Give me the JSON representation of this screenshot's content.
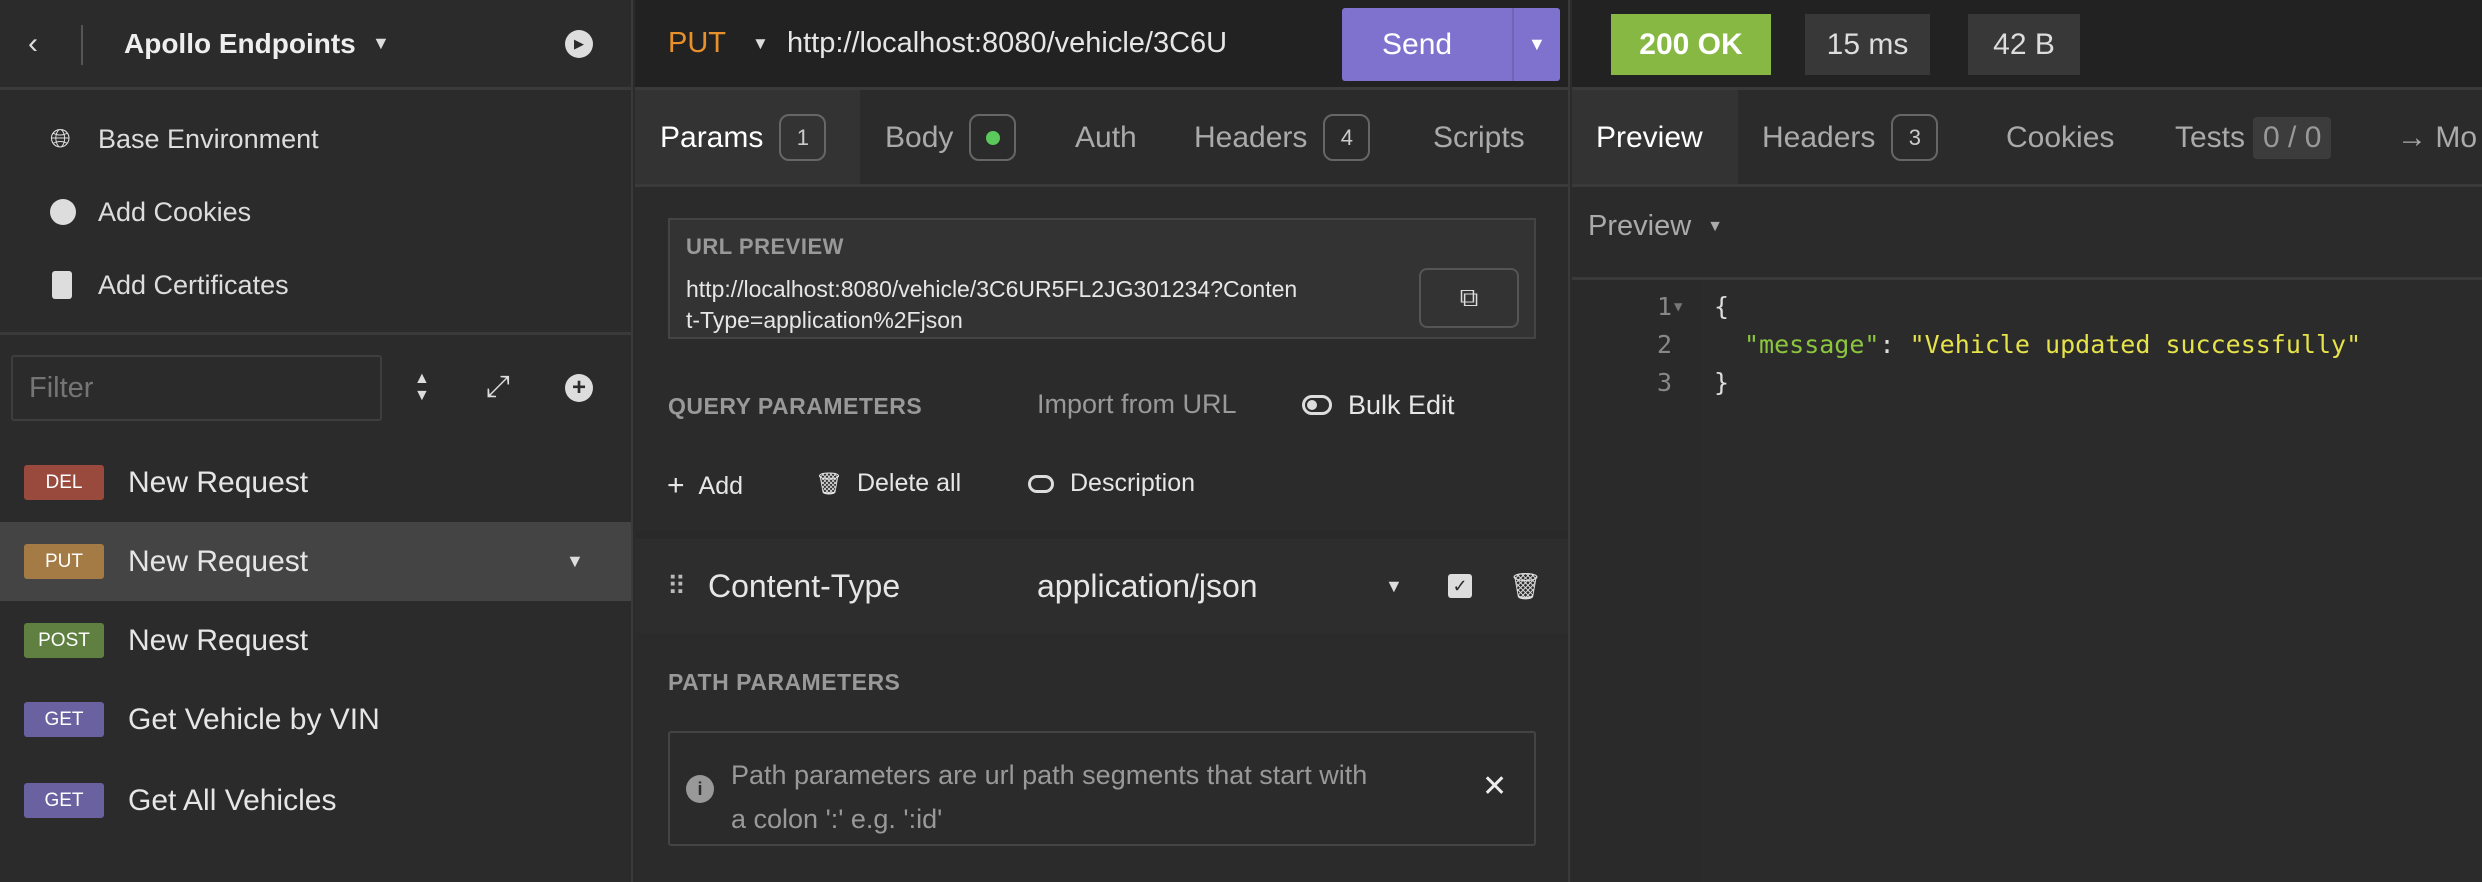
{
  "sidebar": {
    "title": "Apollo Endpoints",
    "items": [
      {
        "label": "Base Environment",
        "icon": "globe-icon"
      },
      {
        "label": "Add Cookies",
        "icon": "cookie-icon"
      },
      {
        "label": "Add Certificates",
        "icon": "certificate-icon"
      }
    ],
    "filter_placeholder": "Filter",
    "requests": [
      {
        "method": "DEL",
        "name": "New Request",
        "color": "#9a4a3c"
      },
      {
        "method": "PUT",
        "name": "New Request",
        "color": "#a47a45",
        "selected": true
      },
      {
        "method": "POST",
        "name": "New Request",
        "color": "#5f8040"
      },
      {
        "method": "GET",
        "name": "Get Vehicle by VIN",
        "color": "#6a62a0"
      },
      {
        "method": "GET",
        "name": "Get All Vehicles",
        "color": "#6a62a0"
      }
    ]
  },
  "request": {
    "method": "PUT",
    "url": "http://localhost:8080/vehicle/3C6U",
    "send": "Send",
    "tabs": [
      {
        "label": "Params",
        "count": "1"
      },
      {
        "label": "Body"
      },
      {
        "label": "Auth"
      },
      {
        "label": "Headers",
        "count": "4"
      },
      {
        "label": "Scripts"
      }
    ],
    "url_preview_label": "URL PREVIEW",
    "url_preview_line1": "http://localhost:8080/vehicle/3C6UR5FL2JG301234?Conten",
    "url_preview_line2": "t-Type=application%2Fjson",
    "query_label": "QUERY PARAMETERS",
    "import_label": "Import from URL",
    "bulk_edit": "Bulk Edit",
    "add": "Add",
    "delete_all": "Delete all",
    "description": "Description",
    "param": {
      "name": "Content-Type",
      "value": "application/json",
      "enabled": true
    },
    "path_label": "PATH PARAMETERS",
    "path_info_1": "Path parameters are url path segments that start with",
    "path_info_2": "a colon ':' e.g. ':id'"
  },
  "response": {
    "status": "200 OK",
    "time": "15 ms",
    "size": "42 B",
    "status_color": "#86b843",
    "tabs": [
      {
        "label": "Preview"
      },
      {
        "label": "Headers",
        "count": "3"
      },
      {
        "label": "Cookies"
      },
      {
        "label": "Tests",
        "count": "0 / 0"
      },
      {
        "label": "→ Mo"
      }
    ],
    "preview_mode": "Preview",
    "lines": [
      {
        "n": "1",
        "t": "{"
      },
      {
        "n": "2",
        "k": "\"message\"",
        "s": "\"Vehicle updated successfully\""
      },
      {
        "n": "3",
        "t": "}"
      }
    ]
  }
}
